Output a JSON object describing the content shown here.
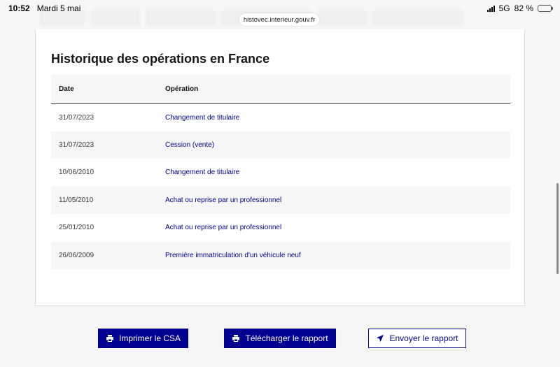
{
  "status_bar": {
    "time": "10:52",
    "date": "Mardi 5 mai",
    "network": "5G",
    "battery": "82 %",
    "battery_level": 0.82
  },
  "browser": {
    "url": "histovec.interieur.gouv.fr"
  },
  "section": {
    "title": "Historique des opérations en France"
  },
  "table": {
    "headers": {
      "date": "Date",
      "operation": "Opération"
    },
    "rows": [
      {
        "date": "31/07/2023",
        "operation": "Changement de titulaire"
      },
      {
        "date": "31/07/2023",
        "operation": "Cession (vente)"
      },
      {
        "date": "10/06/2010",
        "operation": "Changement de titulaire"
      },
      {
        "date": "11/05/2010",
        "operation": "Achat ou reprise par un professionnel"
      },
      {
        "date": "25/01/2010",
        "operation": "Achat ou reprise par un professionnel"
      },
      {
        "date": "26/06/2009",
        "operation": "Première immatriculation d'un véhicule neuf"
      }
    ]
  },
  "actions": {
    "print_label": "Imprimer le CSA",
    "download_label": "Télécharger le rapport",
    "send_label": "Envoyer le rapport",
    "print_icon": "printer-icon",
    "download_icon": "printer-icon",
    "send_icon": "send-icon"
  },
  "colors": {
    "primary": "#000091",
    "link": "#000091",
    "text": "#161616",
    "row_alt": "#f6f6f6"
  }
}
